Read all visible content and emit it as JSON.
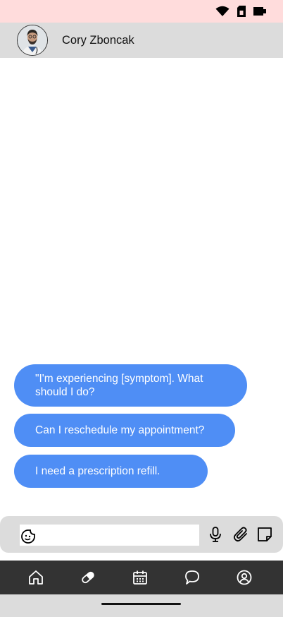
{
  "status_bar": {
    "icons": [
      "wifi-icon",
      "sim-card-icon",
      "battery-icon"
    ]
  },
  "header": {
    "contact_name": "Cory Zboncak",
    "avatar": "avatar-photo"
  },
  "suggestions": [
    "\"I'm experiencing [symptom]. What should I do?",
    "Can I reschedule my appointment?",
    "I need a prescription refill."
  ],
  "composer": {
    "input_value": "",
    "input_placeholder": "",
    "icons": [
      "sticker-icon",
      "microphone-icon",
      "paperclip-icon",
      "note-icon"
    ]
  },
  "bottom_nav": {
    "items": [
      "home-icon",
      "pill-icon",
      "calendar-icon",
      "chat-bubble-icon",
      "profile-icon"
    ]
  },
  "colors": {
    "status_bar_bg": "#ffdcdc",
    "header_bg": "#dcdcdc",
    "suggestion_bg": "#4f8ef5",
    "nav_bg": "#333333"
  }
}
